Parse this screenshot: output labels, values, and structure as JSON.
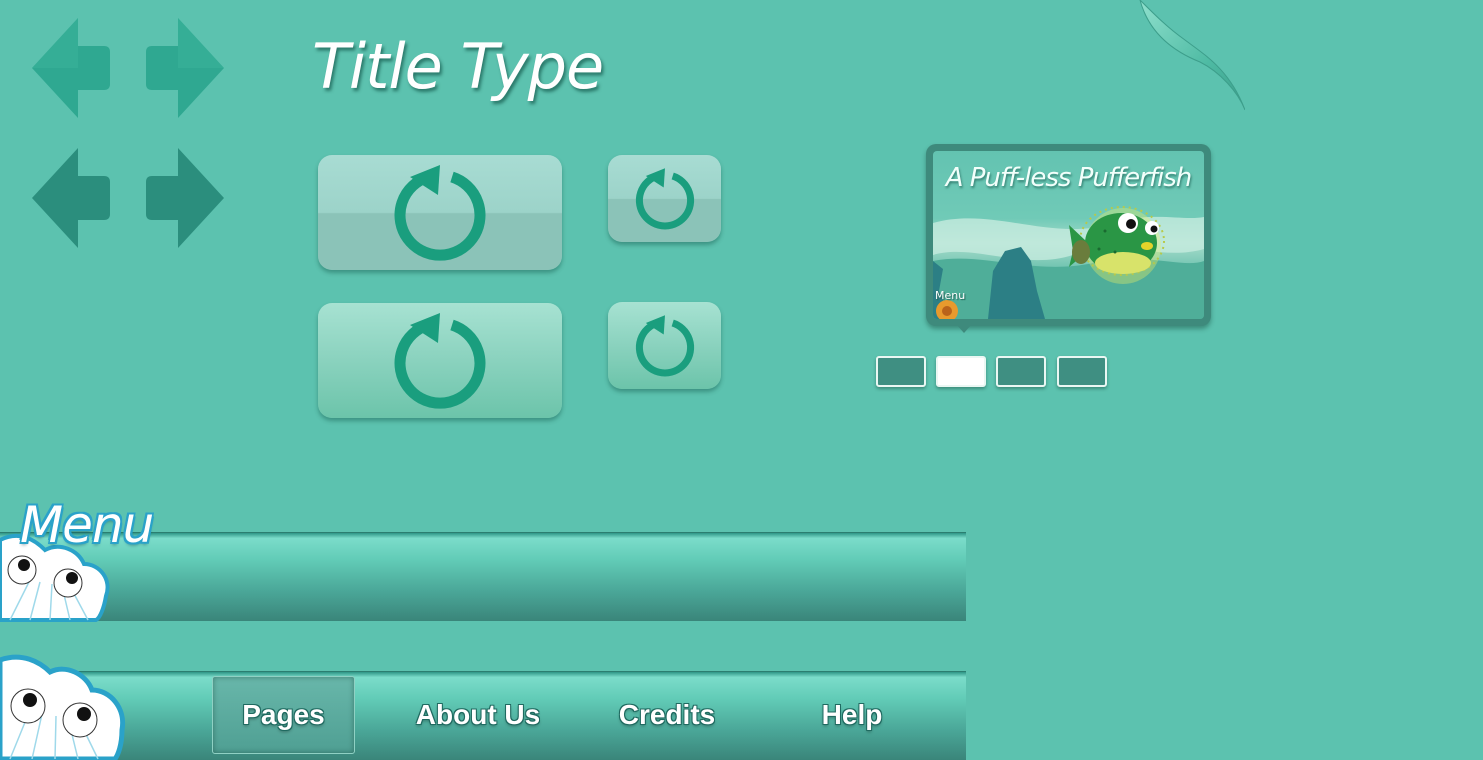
{
  "title": "Title Type",
  "book": {
    "title": "A Puff-less Pufferfish",
    "menu_label": "Menu"
  },
  "page_dots": {
    "count": 4,
    "active_index": 1
  },
  "menu_label": "Menu",
  "nav": {
    "items": [
      {
        "label": "Pages",
        "selected": true
      },
      {
        "label": "About Us",
        "selected": false
      },
      {
        "label": "Credits",
        "selected": false
      },
      {
        "label": "Help",
        "selected": false
      }
    ]
  },
  "colors": {
    "background": "#5cc2af",
    "arrow_light": "#2fa891",
    "arrow_dark": "#2b8e7d",
    "refresh_icon": "#1a9e7e",
    "shell_outline": "#2aa2c9"
  },
  "icons": [
    "arrow-left-icon",
    "arrow-right-icon",
    "refresh-icon",
    "page-curl-icon",
    "shell-icon",
    "pufferfish-icon"
  ]
}
